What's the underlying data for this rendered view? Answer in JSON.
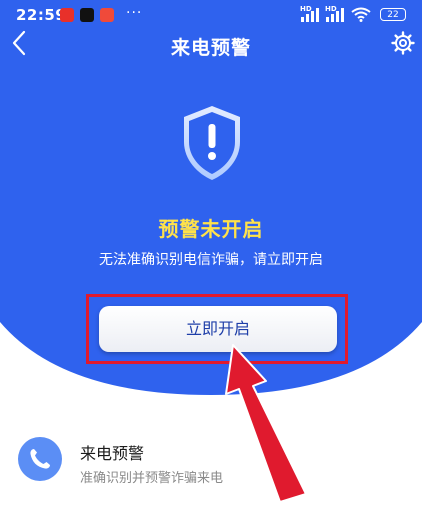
{
  "colors": {
    "hero_blue": "#2f62ee",
    "warning_yellow": "#ffe24a",
    "button_text": "#1e3ea8",
    "annotation_red": "#e01a2e",
    "phone_icon_bg": "#5b8ef5"
  },
  "status_bar": {
    "time": "22:59",
    "more": "···",
    "network_label_1": "HD",
    "network_label_2": "HD",
    "battery": "22"
  },
  "nav": {
    "title": "来电预警",
    "back_icon": "chevron-left-icon",
    "settings_icon": "gear-icon"
  },
  "warning": {
    "shield_icon": "shield-exclamation-icon",
    "title": "预警未开启",
    "description": "无法准确识别电信诈骗，请立即开启"
  },
  "action": {
    "button_label": "立即开启"
  },
  "feature_item": {
    "icon": "phone-icon",
    "title": "来电预警",
    "subtitle": "准确识别并预警诈骗来电"
  }
}
